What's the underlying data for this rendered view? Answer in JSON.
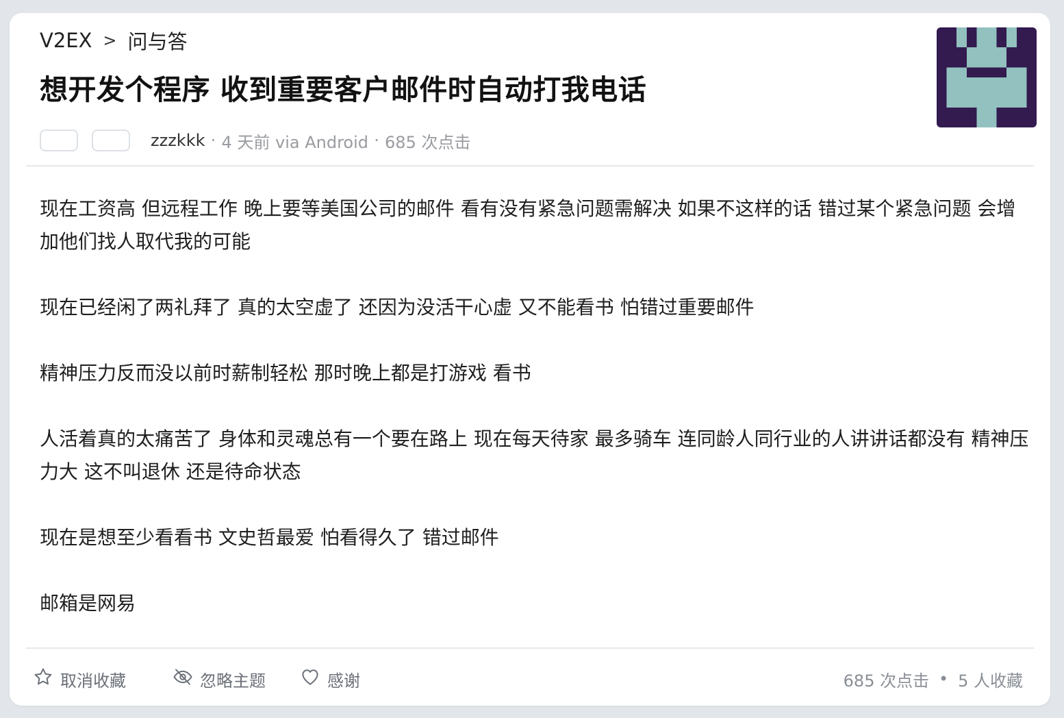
{
  "breadcrumb": {
    "site": "V2EX",
    "separator": ">",
    "node": "问与答"
  },
  "topic": {
    "title": "想开发个程序 收到重要客户邮件时自动打我电话",
    "author": "zzzkkk",
    "time": "4 天前 via Android",
    "clicks": "685 次点击",
    "separator": "·"
  },
  "content": {
    "paragraphs": [
      "现在工资高 但远程工作 晚上要等美国公司的邮件 看有没有紧急问题需解决 如果不这样的话 错过某个紧急问题 会增加他们找人取代我的可能",
      "现在已经闲了两礼拜了 真的太空虚了 还因为没活干心虚 又不能看书 怕错过重要邮件",
      "精神压力反而没以前时薪制轻松 那时晚上都是打游戏 看书",
      "人活着真的太痛苦了 身体和灵魂总有一个要在路上 现在每天待家 最多骑车 连同龄人同行业的人讲讲话都没有 精神压力大 这不叫退休 还是待命状态",
      "现在是想至少看看书 文史哲最爱 怕看得久了 错过邮件",
      "邮箱是网易"
    ]
  },
  "footer": {
    "unfavorite_label": "取消收藏",
    "ignore_label": "忽略主题",
    "thank_label": "感谢",
    "clicks": "685 次点击",
    "separator": "•",
    "favorites": "5 人收藏"
  },
  "colors": {
    "avatar_bg": "#331a4f",
    "avatar_fg": "#92c1bf",
    "page_bg": "#e2e6ea",
    "card_bg": "#ffffff"
  },
  "icons": {
    "vote_up": "vote-up-button",
    "vote_down": "vote-down-button",
    "unfavorite": "star-icon",
    "ignore": "eye-slash-icon",
    "thank": "heart-icon"
  }
}
